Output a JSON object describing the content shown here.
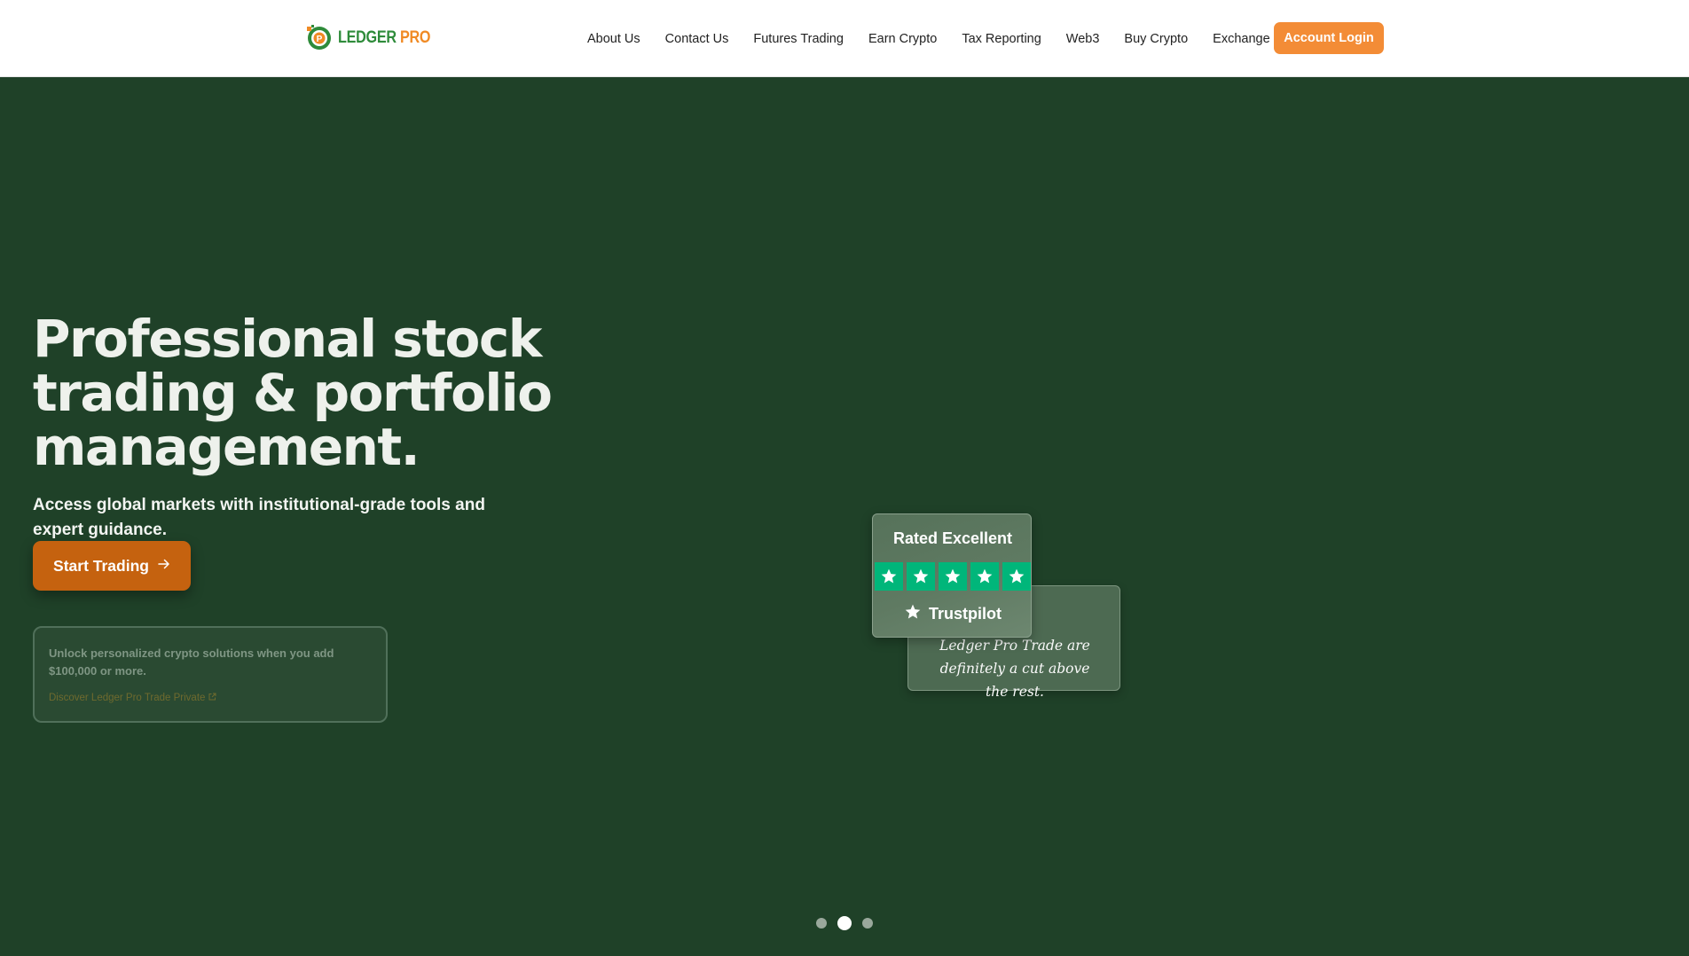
{
  "brand": {
    "name_part1": "LEDGER",
    "name_part2": "PRO",
    "colors": {
      "green": "#2e8b3a",
      "orange": "#f08a24"
    }
  },
  "nav": {
    "items": [
      {
        "label": "About Us"
      },
      {
        "label": "Contact Us"
      },
      {
        "label": "Futures Trading"
      },
      {
        "label": "Earn Crypto"
      },
      {
        "label": "Tax Reporting"
      },
      {
        "label": "Web3"
      },
      {
        "label": "Buy Crypto"
      },
      {
        "label": "Exchange"
      }
    ],
    "login_label": "Account Login"
  },
  "hero": {
    "title_line1": "Professional stock",
    "title_line2": "trading & portfolio",
    "title_line3": "management.",
    "subtitle": "Access global markets with institutional-grade tools and expert guidance.",
    "cta_label": "Start Trading",
    "cta_icon": "arrow-right-icon"
  },
  "private": {
    "text_prefix": "Unlock personalized crypto solutions when you add ",
    "amount": "$100,000",
    "text_suffix": " or more.",
    "link_label": "Discover Ledger Pro Trade Private",
    "link_icon": "external-link-icon"
  },
  "review": {
    "rating_title": "Rated Excellent",
    "stars": 5,
    "provider": "Trustpilot",
    "quote": "Ledger Pro Trade are definitely a cut above the rest.",
    "star_color": "#00b67a"
  },
  "carousel": {
    "total": 3,
    "active": 2
  },
  "colors": {
    "background": "#1f4128",
    "accent": "#f38c36",
    "cta": "#c5620f"
  }
}
